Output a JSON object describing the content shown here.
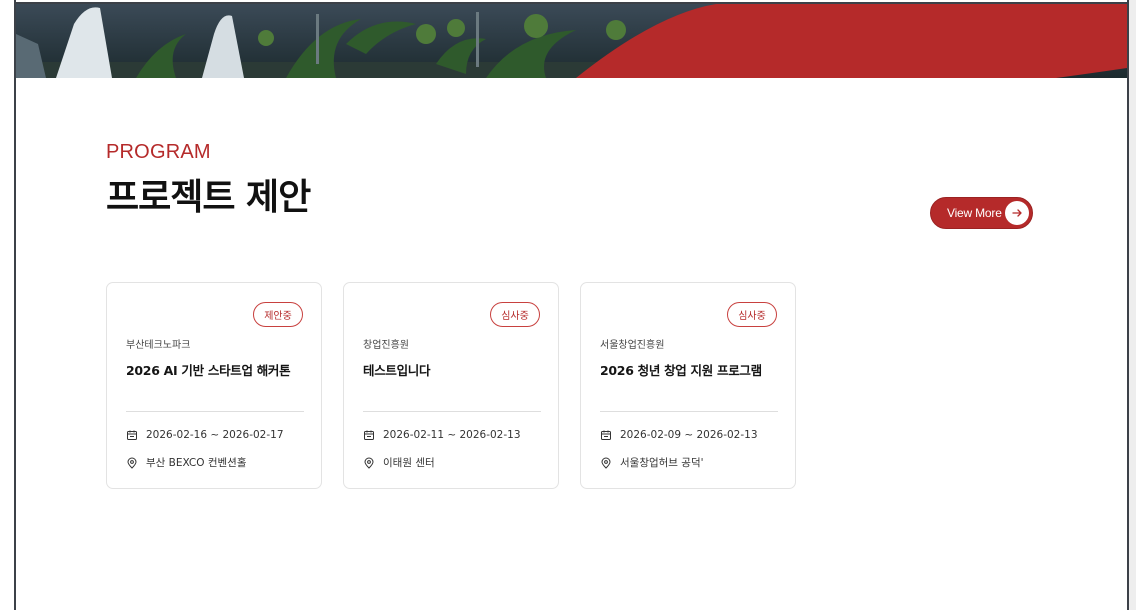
{
  "section": {
    "eyebrow": "PROGRAM",
    "headline": "프로젝트 제안",
    "view_more_label": "View More"
  },
  "colors": {
    "accent": "#b52a2a",
    "frame": "#3c4148"
  },
  "cards": [
    {
      "badge": "제안중",
      "org": "부산테크노파크",
      "title": "2026 AI 기반 스타트업 해커톤",
      "period": "2026-02-16 ~ 2026-02-17",
      "place": "부산 BEXCO 컨벤션홀"
    },
    {
      "badge": "심사중",
      "org": "창업진흥원",
      "title": "테스트입니다",
      "period": "2026-02-11 ~ 2026-02-13",
      "place": "이태원 센터"
    },
    {
      "badge": "심사중",
      "org": "서울창업진흥원",
      "title": "2026 청년 창업 지원 프로그램",
      "period": "2026-02-09 ~ 2026-02-13",
      "place": "서울창업허브 공덕'"
    }
  ],
  "icons": {
    "date": "calendar-icon",
    "place": "location-pin-icon",
    "view_more": "arrow-right-icon"
  }
}
